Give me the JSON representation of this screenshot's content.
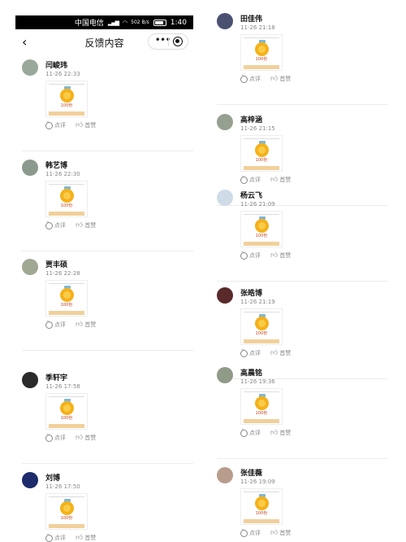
{
  "status_bar": {
    "carrier": "中国电信",
    "speed": "502 B/s",
    "time": "1:40"
  },
  "nav": {
    "title": "反馈内容",
    "more_icon": "more-dots-icon",
    "close_icon": "target-close-icon"
  },
  "actions": {
    "comment": "点评",
    "like": "首赞"
  },
  "thumbnail": {
    "amount": "100份"
  },
  "colors": {
    "coin": "#f5b11a",
    "bar": "#f1d09b",
    "text_meta": "#888888"
  },
  "left_items": [
    {
      "name": "闫峻玮",
      "time": "11-26 22:33",
      "avatar_color": "#9aa89a"
    },
    {
      "name": "韩艺博",
      "time": "11-26 22:30",
      "avatar_color": "#8c9a8e"
    },
    {
      "name": "贾丰硕",
      "time": "11-26 22:28",
      "avatar_color": "#a0a894"
    },
    {
      "name": "季轩宇",
      "time": "11-26 17:58",
      "avatar_color": "#2a2a2a"
    },
    {
      "name": "刘博",
      "time": "11-26 17:50",
      "avatar_color": "#1d2b6b"
    }
  ],
  "right_items": [
    {
      "name": "田佳伟",
      "time": "11-26 21:18",
      "avatar_color": "#4a5070"
    },
    {
      "name": "高梓涵",
      "time": "11-26 21:15",
      "avatar_color": "#96a090"
    },
    {
      "name": "杨云飞",
      "time": "11-26 21:09",
      "avatar_color": "#cfdbe6"
    },
    {
      "name": "张皓博",
      "time": "11-26 21:19",
      "avatar_color": "#5a2a2a"
    },
    {
      "name": "高晨铭",
      "time": "11-26 19:36",
      "avatar_color": "#909a88"
    },
    {
      "name": "张佳薇",
      "time": "11-26 19:09",
      "avatar_color": "#b89c8c"
    }
  ]
}
